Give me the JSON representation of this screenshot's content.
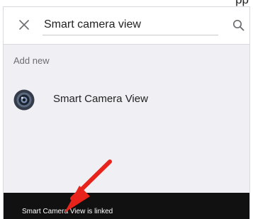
{
  "header": {
    "partial_title": "pp"
  },
  "search": {
    "close_icon": "close-icon",
    "value": "Smart camera view",
    "search_icon": "search-icon"
  },
  "section": {
    "label": "Add new"
  },
  "results": [
    {
      "label": "Smart Camera View",
      "icon": "camera-lens-icon"
    }
  ],
  "toast": {
    "message": "Smart Camera View is linked"
  },
  "annotation": {
    "icon": "red-arrow-icon",
    "color": "#e8231b"
  },
  "colors": {
    "background": "#f0eff4",
    "search_bar": "#ffffff",
    "toast_background": "#111111",
    "text": "#222222",
    "secondary_text": "#6d6d72"
  }
}
